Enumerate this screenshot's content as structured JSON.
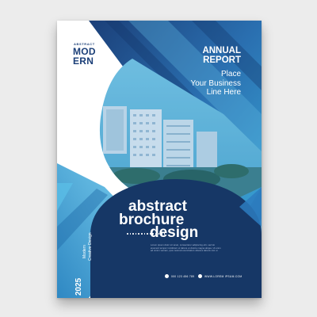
{
  "brand": {
    "small": "ABSTRACT",
    "line1": "MOD",
    "line2": "ERN"
  },
  "header": {
    "title_line1": "ANNUAL",
    "title_line2": "REPORT",
    "subtitle_lines": [
      "Place",
      "Your Business",
      "Line Here"
    ]
  },
  "headline": {
    "line1": "abstract",
    "line2": "brochure",
    "line3": "design"
  },
  "body_text_lines": [
    "Lorem ipsum dolor sit amet, consectetur adipiscing elit, sed do",
    "eiusmod tempor incididunt ut labore et dolore magna aliqua. Ut enim",
    "ad minim veniam, quis nostrud exercitation ullamco laboris nisi ut"
  ],
  "footer": {
    "year": "2025",
    "tagline_line1": "Modern",
    "tagline_line2": "Creative Design",
    "phone": "000 123 456 789",
    "website": "WWW.LOREM IPSUM.COM"
  },
  "colors": {
    "navy": "#1b3f78",
    "blue": "#2a6fb0",
    "cyan": "#3aa6d6",
    "dark_navy": "#163766"
  },
  "icons": [
    "phone-icon",
    "globe-icon"
  ]
}
